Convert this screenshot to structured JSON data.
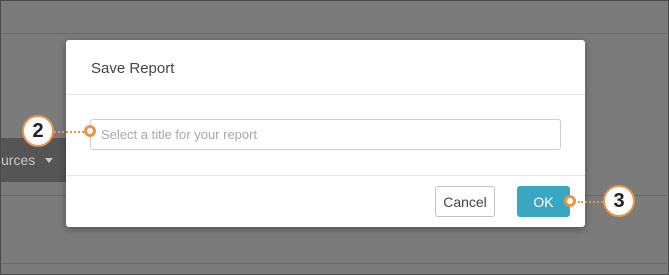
{
  "background": {
    "sources_label": "urces"
  },
  "dialog": {
    "title": "Save Report",
    "title_input": {
      "value": "",
      "placeholder": "Select a title for your report"
    },
    "cancel_label": "Cancel",
    "ok_label": "OK"
  },
  "callouts": {
    "title_input_step": "2",
    "ok_button_step": "3"
  },
  "colors": {
    "accent": "#3aa7c2",
    "callout": "#e8954a",
    "overlay": "#7b7b7b"
  }
}
